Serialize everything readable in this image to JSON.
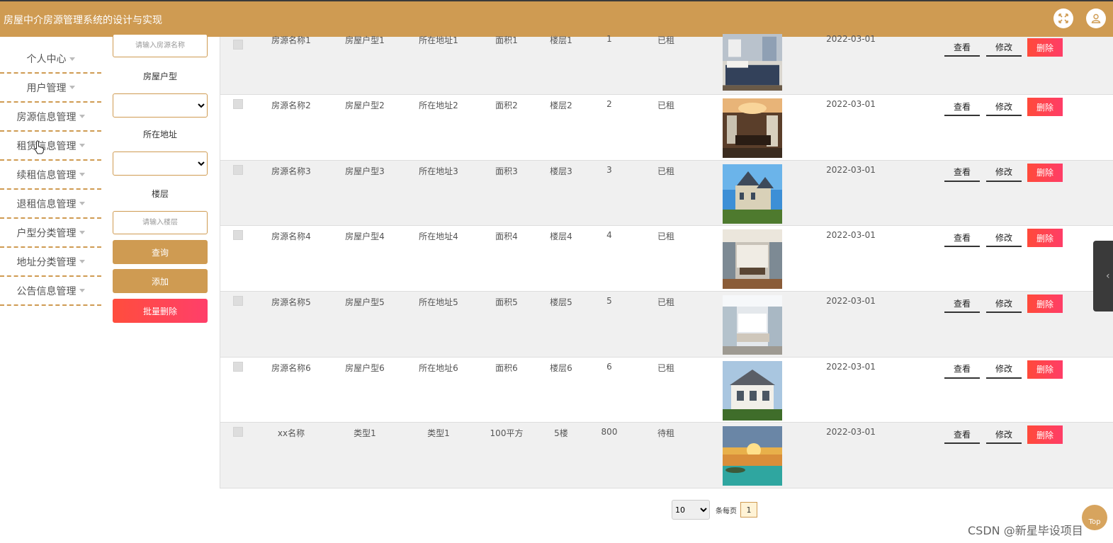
{
  "header": {
    "title": "房屋中介房源管理系统的设计与实现",
    "fullscreen_icon": "fullscreen-icon",
    "user_icon": "user-icon"
  },
  "sidebar": {
    "items": [
      {
        "label": "个人中心"
      },
      {
        "label": "用户管理"
      },
      {
        "label": "房源信息管理"
      },
      {
        "label": "租赁信息管理"
      },
      {
        "label": "续租信息管理"
      },
      {
        "label": "退租信息管理"
      },
      {
        "label": "户型分类管理"
      },
      {
        "label": "地址分类管理"
      },
      {
        "label": "公告信息管理"
      }
    ]
  },
  "filter": {
    "name_placeholder": "请输入房源名称",
    "type_label": "房屋户型",
    "address_label": "所在地址",
    "floor_label": "楼层",
    "floor_placeholder": "请输入楼层",
    "query_label": "查询",
    "add_label": "添加",
    "batch_delete_label": "批量删除"
  },
  "table": {
    "view_label": "查看",
    "edit_label": "修改",
    "delete_label": "删除",
    "rows": [
      {
        "name": "房源名称1",
        "type": "房屋户型1",
        "address": "所在地址1",
        "area": "面积1",
        "floor": "楼层1",
        "price": "1",
        "status": "已租",
        "date": "2022-03-01",
        "image": "bedroom"
      },
      {
        "name": "房源名称2",
        "type": "房屋户型2",
        "address": "所在地址2",
        "area": "面积2",
        "floor": "楼层2",
        "price": "2",
        "status": "已租",
        "date": "2022-03-01",
        "image": "dining-room"
      },
      {
        "name": "房源名称3",
        "type": "房屋户型3",
        "address": "所在地址3",
        "area": "面积3",
        "floor": "楼层3",
        "price": "3",
        "status": "已租",
        "date": "2022-03-01",
        "image": "victorian-house"
      },
      {
        "name": "房源名称4",
        "type": "房屋户型4",
        "address": "所在地址4",
        "area": "面积4",
        "floor": "楼层4",
        "price": "4",
        "status": "已租",
        "date": "2022-03-01",
        "image": "living-room"
      },
      {
        "name": "房源名称5",
        "type": "房屋户型5",
        "address": "所在地址5",
        "area": "面积5",
        "floor": "楼层5",
        "price": "5",
        "status": "已租",
        "date": "2022-03-01",
        "image": "bright-living-room"
      },
      {
        "name": "房源名称6",
        "type": "房屋户型6",
        "address": "所在地址6",
        "area": "面积6",
        "floor": "楼层6",
        "price": "6",
        "status": "已租",
        "date": "2022-03-01",
        "image": "white-villa"
      },
      {
        "name": "xx名称",
        "type": "类型1",
        "address": "类型1",
        "area": "100平方",
        "floor": "5楼",
        "price": "800",
        "status": "待租",
        "date": "2022-03-01",
        "image": "sunset-lake"
      }
    ]
  },
  "pager": {
    "page_size": "10",
    "per_page_label": "条每页",
    "current_page": "1"
  },
  "top_label": "Top",
  "watermark": "CSDN @新星毕设项目",
  "colors": {
    "brand": "#cf9b52",
    "danger": "#ff4a3a",
    "row_alt": "#f0f0f0"
  }
}
